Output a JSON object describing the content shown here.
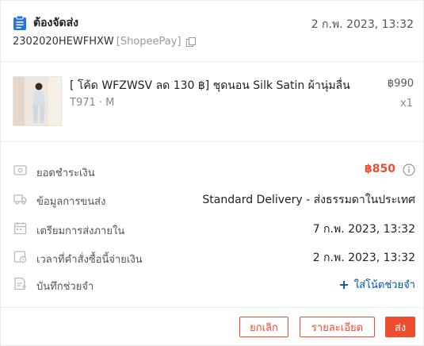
{
  "header": {
    "status": "ต้องจัดส่ง",
    "date": "2 ก.พ. 2023, 13:32",
    "order_id": "2302020HEWFHXW",
    "payment": "[ShopeePay]"
  },
  "product": {
    "name": "[ โค้ด WFZWSV ลด 130 ฿] ชุดนอน Silk Satin ผ้านุ่มลื่น",
    "variation": "T971 · M",
    "price": "฿990",
    "qty": "x1"
  },
  "info": {
    "total_label": "ยอดชำระเงิน",
    "total_value": "฿850",
    "shipping_label": "ข้อมูลการขนส่ง",
    "shipping_value": "Standard Delivery - ส่งธรรมดาในประเทศ",
    "ship_by_label": "เตรียมการส่งภายใน",
    "ship_by_value": "7 ก.พ. 2023, 13:32",
    "paid_label": "เวลาที่คำสั่งซื้อนี้จ่ายเงิน",
    "paid_value": "2 ก.พ. 2023, 13:32",
    "note_label": "บันทึกช่วยจำ",
    "note_action": "ใส่โน้ตช่วยจำ"
  },
  "actions": {
    "cancel": "ยกเลิก",
    "details": "รายละเอียด",
    "ship": "ส่ง"
  },
  "colors": {
    "brand": "#ee4d2d",
    "status_icon": "#2673dd",
    "link": "#0055aa"
  },
  "icons": {
    "status": "clipboard-icon",
    "copy": "copy-icon",
    "total": "wallet-icon",
    "shipping": "truck-icon",
    "ship_by": "calendar-icon",
    "paid": "clock-icon",
    "note": "note-icon",
    "info": "info-icon"
  }
}
